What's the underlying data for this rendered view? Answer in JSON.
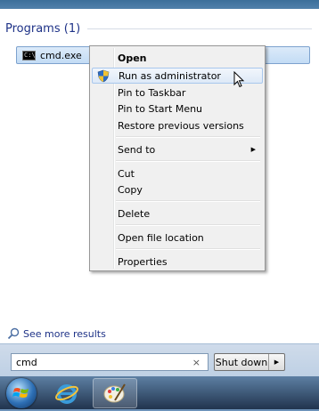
{
  "start_menu": {
    "programs_header": "Programs (1)",
    "program_item": {
      "label": "cmd.exe",
      "icon": "cmd-console-icon",
      "icon_text": "C:\\"
    },
    "see_more": "See more results",
    "search": {
      "value": "cmd",
      "clear_glyph": "×"
    },
    "shutdown": {
      "label": "Shut down",
      "arrow": "▶"
    }
  },
  "context_menu": {
    "items": [
      {
        "label": "Open",
        "bold": true
      },
      {
        "label": "Run as administrator",
        "icon": "uac-shield-icon",
        "highlighted": true
      },
      {
        "label": "Pin to Taskbar"
      },
      {
        "label": "Pin to Start Menu"
      },
      {
        "label": "Restore previous versions"
      },
      {
        "label": "Send to",
        "submenu_arrow": "▶"
      },
      {
        "label": "Cut"
      },
      {
        "label": "Copy"
      },
      {
        "label": "Delete"
      },
      {
        "label": "Open file location"
      },
      {
        "label": "Properties"
      }
    ]
  },
  "taskbar": {
    "items": [
      {
        "icon": "windows-start-orb-icon"
      },
      {
        "icon": "internet-explorer-icon"
      },
      {
        "icon": "paint-icon",
        "active": true
      }
    ]
  }
}
